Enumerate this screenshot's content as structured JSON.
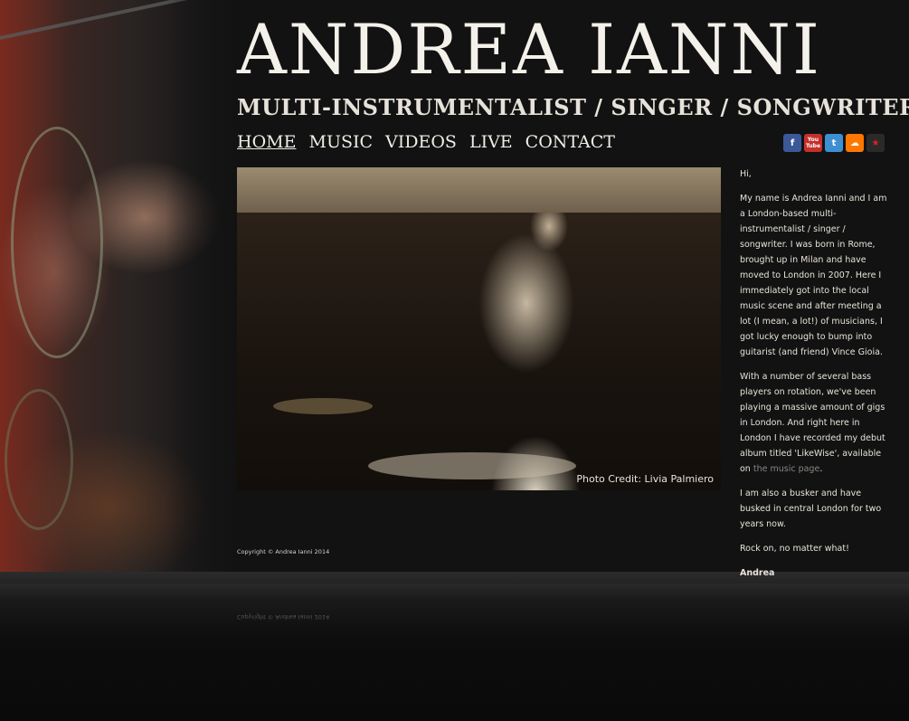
{
  "header": {
    "title": "ANDREA IANNI",
    "subtitle": "MULTI-INSTRUMENTALIST / SINGER / SONGWRITER"
  },
  "nav": {
    "items": [
      {
        "label": "HOME",
        "active": true
      },
      {
        "label": "MUSIC",
        "active": false
      },
      {
        "label": "VIDEOS",
        "active": false
      },
      {
        "label": "LIVE",
        "active": false
      },
      {
        "label": "CONTACT",
        "active": false
      }
    ]
  },
  "social": [
    {
      "name": "facebook-icon",
      "glyph": "f",
      "color": "#3b5998"
    },
    {
      "name": "youtube-icon",
      "glyph": "You\nTube",
      "color": "#c4302b"
    },
    {
      "name": "twitter-icon",
      "glyph": "t",
      "color": "#3d8fd1"
    },
    {
      "name": "soundcloud-icon",
      "glyph": "☁",
      "color": "#ff7700"
    },
    {
      "name": "reverbnation-icon",
      "glyph": "★",
      "color": "#c81e1e"
    }
  ],
  "photo": {
    "credit": "Photo Credit: Livia Palmiero"
  },
  "bio": {
    "greeting": "Hi,",
    "p1": "My name is Andrea Ianni and I am a London-based multi-instrumentalist / singer / songwriter. I was born in Rome, brought up in Milan and have moved to London in 2007. Here I immediately got into the local music scene and after meeting a lot (I mean, a lot!) of musicians, I got lucky enough to bump into guitarist (and friend) Vince Gioia.",
    "p2_before": "With a number of several bass players on rotation, we've been playing a massive amount of gigs in London. And right here in London I have recorded my debut album titled 'LikeWise', available on ",
    "p2_link": "the music page",
    "p2_after": ".",
    "p3": "I am also a busker and have busked in central London for two years now.",
    "p4": "Rock on, no matter what!",
    "signature": "Andrea"
  },
  "footer": {
    "copyright": "Copyright © Andrea Ianni 2014"
  }
}
